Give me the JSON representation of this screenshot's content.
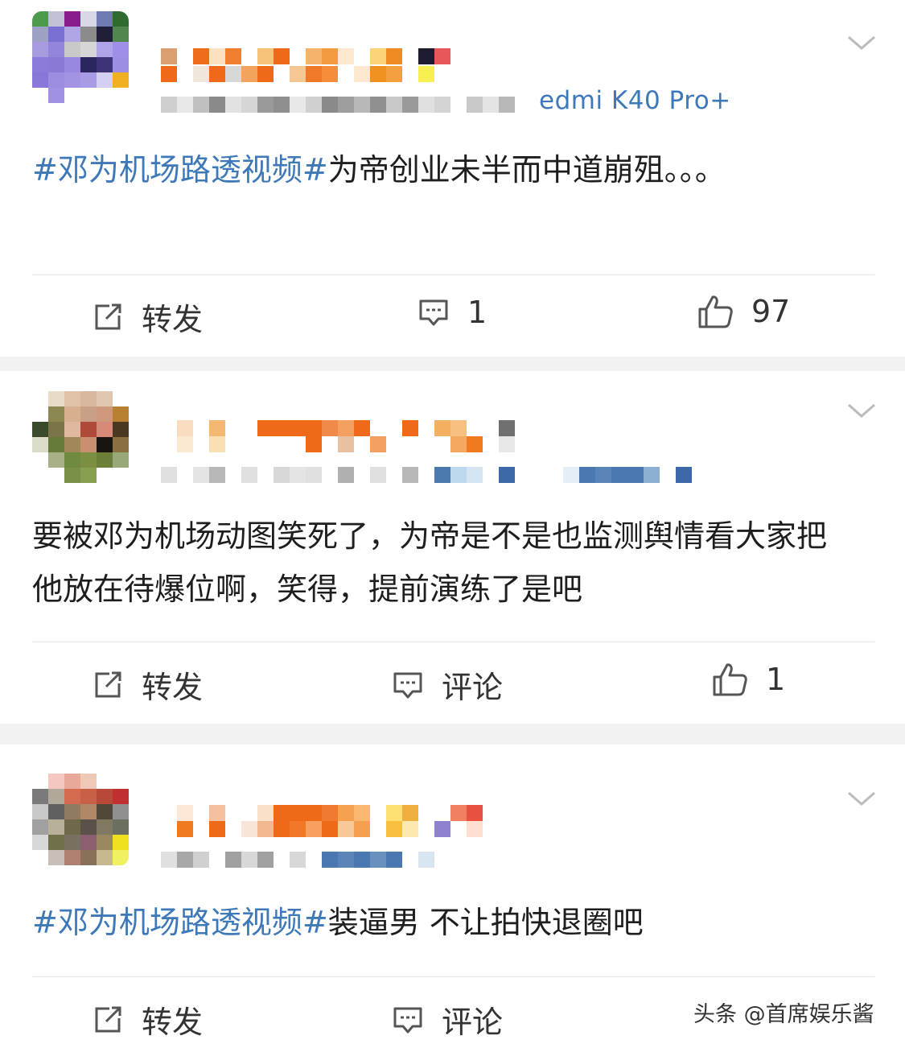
{
  "posts": [
    {
      "device": "edmi K40 Pro+",
      "topic": "#邓为机场路透视频#",
      "text": "为帝创业未半而中道崩殂。。。",
      "actions": {
        "repost": "转发",
        "comment": "1",
        "like": "97"
      }
    },
    {
      "text": "要被邓为机场动图笑死了，为帝是不是也监测舆情看大家把他放在待爆位啊，笑得，提前演练了是吧",
      "actions": {
        "repost": "转发",
        "comment": "评论",
        "like": "1"
      }
    },
    {
      "topic": "#邓为机场路透视频#",
      "text": "装逼男 不让拍快退圈吧",
      "actions": {
        "repost": "转发",
        "comment": "评论"
      }
    }
  ],
  "watermark": "头条 @首席娱乐酱",
  "colors": {
    "topic": "#3d78b8",
    "divider": "#e6e6e6",
    "separator": "#f2f2f2"
  }
}
